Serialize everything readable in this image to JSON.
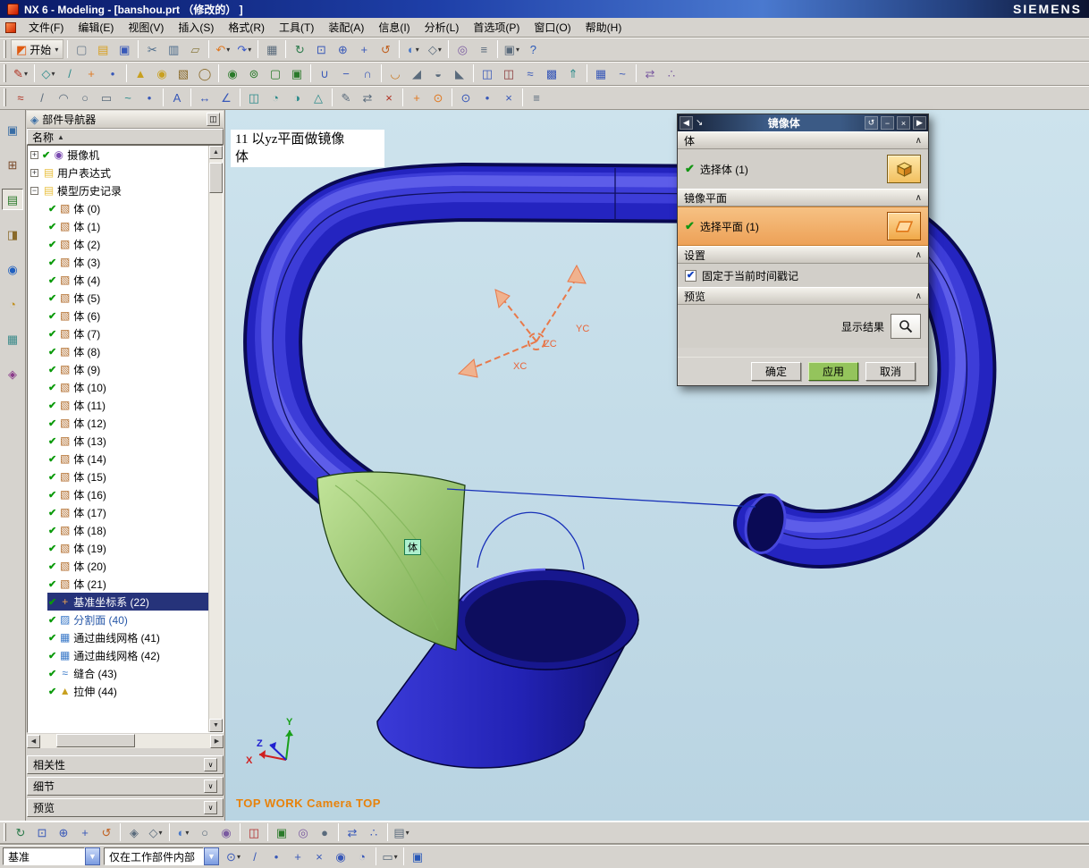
{
  "window": {
    "title": "NX 6 - Modeling - [banshou.prt （修改的） ]",
    "brand": "SIEMENS"
  },
  "glyphs": {
    "dd": "▾",
    "check": "✔",
    "up": "▲",
    "down": "▼",
    "left": "◀",
    "right": "▶",
    "sort": "▲",
    "panel": "∨"
  },
  "menubar": [
    {
      "n": "file",
      "label": "文件(F)"
    },
    {
      "n": "edit",
      "label": "编辑(E)"
    },
    {
      "n": "view",
      "label": "视图(V)"
    },
    {
      "n": "insert",
      "label": "插入(S)"
    },
    {
      "n": "format",
      "label": "格式(R)"
    },
    {
      "n": "tools",
      "label": "工具(T)"
    },
    {
      "n": "assemblies",
      "label": "装配(A)"
    },
    {
      "n": "information",
      "label": "信息(I)"
    },
    {
      "n": "analysis",
      "label": "分析(L)"
    },
    {
      "n": "preferences",
      "label": "首选项(P)"
    },
    {
      "n": "window",
      "label": "窗口(O)"
    },
    {
      "n": "help",
      "label": "帮助(H)"
    }
  ],
  "toolbars": {
    "row1": [
      {
        "t": "grip"
      },
      {
        "n": "start",
        "label": "开始",
        "g": "◩",
        "c": "#e05a10",
        "dd": true
      },
      {
        "t": "sep"
      },
      {
        "n": "new",
        "g": "▢",
        "c": "#6a7b8c"
      },
      {
        "n": "open",
        "g": "▤",
        "c": "#d8a020"
      },
      {
        "n": "save",
        "g": "▣",
        "c": "#3858b8"
      },
      {
        "t": "sep"
      },
      {
        "n": "cut",
        "g": "✂",
        "c": "#4a6a8a"
      },
      {
        "n": "copy",
        "g": "▥",
        "c": "#4a6a8a"
      },
      {
        "n": "paste",
        "g": "▱",
        "c": "#8a7a40"
      },
      {
        "t": "sep"
      },
      {
        "n": "undo",
        "g": "↶",
        "c": "#e07820",
        "dd": true
      },
      {
        "n": "redo",
        "g": "↷",
        "c": "#3858c8",
        "dd": true
      },
      {
        "t": "sep"
      },
      {
        "n": "print",
        "g": "▦",
        "c": "#5a6b7c"
      },
      {
        "t": "sep"
      },
      {
        "n": "refresh-display",
        "g": "↻",
        "c": "#2a7a4a"
      },
      {
        "n": "fit-window",
        "g": "⊡",
        "c": "#3858b8"
      },
      {
        "n": "zoom-in-out",
        "g": "⊕",
        "c": "#3858b8"
      },
      {
        "n": "pan",
        "g": "+",
        "c": "#3858b8"
      },
      {
        "n": "rotate-display",
        "g": "↺",
        "c": "#c06020"
      },
      {
        "t": "sep"
      },
      {
        "n": "shaded-display",
        "g": "◐",
        "c": "#4878c8",
        "dd": true
      },
      {
        "n": "wireframe-display",
        "g": "◇",
        "c": "#5a6b7c",
        "dd": true
      },
      {
        "t": "sep"
      },
      {
        "n": "show-and-hide",
        "g": "◎",
        "c": "#7a5aa0"
      },
      {
        "n": "layer-settings",
        "g": "≡",
        "c": "#5a6b7c"
      },
      {
        "t": "sep"
      },
      {
        "n": "window-menu",
        "g": "▣",
        "c": "#5a6b7c",
        "dd": true
      },
      {
        "n": "help",
        "g": "?",
        "c": "#2858b8"
      }
    ],
    "row2": [
      {
        "t": "grip"
      },
      {
        "n": "sketch",
        "g": "✎",
        "c": "#b03020",
        "dd": true
      },
      {
        "t": "sep"
      },
      {
        "n": "datum-plane",
        "g": "◇",
        "c": "#2a8a8a",
        "dd": true
      },
      {
        "n": "datum-axis",
        "g": "/",
        "c": "#2a8a8a"
      },
      {
        "n": "datum-csys",
        "g": "+",
        "c": "#e07820"
      },
      {
        "n": "point",
        "g": "•",
        "c": "#3858b8"
      },
      {
        "t": "sep"
      },
      {
        "n": "extrude",
        "g": "▲",
        "c": "#c8a020"
      },
      {
        "n": "revolve",
        "g": "◉",
        "c": "#c8a020"
      },
      {
        "n": "block",
        "g": "▧",
        "c": "#8a6a2a"
      },
      {
        "n": "cylinder",
        "g": "◯",
        "c": "#8a6a2a"
      },
      {
        "t": "sep"
      },
      {
        "n": "hole",
        "g": "◉",
        "c": "#2a7a2a"
      },
      {
        "n": "boss",
        "g": "⊚",
        "c": "#2a7a2a"
      },
      {
        "n": "pocket",
        "g": "▢",
        "c": "#2a7a2a"
      },
      {
        "n": "pad",
        "g": "▣",
        "c": "#2a7a2a"
      },
      {
        "t": "sep"
      },
      {
        "n": "unite",
        "g": "∪",
        "c": "#3858b8"
      },
      {
        "n": "subtract",
        "g": "−",
        "c": "#3858b8"
      },
      {
        "n": "intersect",
        "g": "∩",
        "c": "#3858b8"
      },
      {
        "t": "sep"
      },
      {
        "n": "edge-blend",
        "g": "◡",
        "c": "#c87820"
      },
      {
        "n": "chamfer",
        "g": "◢",
        "c": "#5a6b7c"
      },
      {
        "n": "shell",
        "g": "◒",
        "c": "#5a6b7c"
      },
      {
        "n": "draft",
        "g": "◣",
        "c": "#5a6b7c"
      },
      {
        "t": "sep"
      },
      {
        "n": "trim-body",
        "g": "◫",
        "c": "#3858b8"
      },
      {
        "n": "split-body",
        "g": "◫",
        "c": "#8a3a3a"
      },
      {
        "n": "sew",
        "g": "≈",
        "c": "#3858b8"
      },
      {
        "n": "patch",
        "g": "▩",
        "c": "#3858b8"
      },
      {
        "n": "offset-surface",
        "g": "⇑",
        "c": "#2a8a8a"
      },
      {
        "t": "sep"
      },
      {
        "n": "through-curve-mesh",
        "g": "▦",
        "c": "#3858b8"
      },
      {
        "n": "swept",
        "g": "~",
        "c": "#3858b8"
      },
      {
        "t": "sep"
      },
      {
        "n": "mirror-body",
        "g": "⇄",
        "c": "#7a5aa0"
      },
      {
        "n": "pattern-feature",
        "g": "∴",
        "c": "#7a5aa0"
      }
    ],
    "row3": [
      {
        "t": "grip"
      },
      {
        "n": "profile",
        "g": "≈",
        "c": "#b03020"
      },
      {
        "n": "line",
        "g": "/",
        "c": "#5a6b7c"
      },
      {
        "n": "arc",
        "g": "◠",
        "c": "#5a6b7c"
      },
      {
        "n": "circle",
        "g": "○",
        "c": "#5a6b7c"
      },
      {
        "n": "rectangle",
        "g": "▭",
        "c": "#5a6b7c"
      },
      {
        "n": "studio-spline",
        "g": "~",
        "c": "#2a8a8a"
      },
      {
        "n": "point-curve",
        "g": "•",
        "c": "#3858b8"
      },
      {
        "t": "sep"
      },
      {
        "n": "text",
        "g": "A",
        "c": "#3858b8"
      },
      {
        "t": "sep"
      },
      {
        "n": "measure-distance",
        "g": "↔",
        "c": "#3858b8"
      },
      {
        "n": "measure-angle",
        "g": "∠",
        "c": "#3858b8"
      },
      {
        "t": "sep"
      },
      {
        "n": "section-analysis",
        "g": "◫",
        "c": "#2a8a8a"
      },
      {
        "n": "curvature-analysis",
        "g": "◔",
        "c": "#2a8a8a"
      },
      {
        "n": "reflection-analysis",
        "g": "◑",
        "c": "#2a8a8a"
      },
      {
        "n": "draft-analysis",
        "g": "△",
        "c": "#2a8a8a"
      },
      {
        "t": "sep"
      },
      {
        "n": "edit-feature",
        "g": "✎",
        "c": "#5a6b7c"
      },
      {
        "n": "move-objects",
        "g": "⇄",
        "c": "#5a6b7c"
      },
      {
        "n": "delete",
        "g": "×",
        "c": "#b03020"
      },
      {
        "t": "sep"
      },
      {
        "n": "wcs-dynamics",
        "g": "+",
        "c": "#e07820"
      },
      {
        "n": "wcs-origin",
        "g": "⊙",
        "c": "#e07820"
      },
      {
        "t": "sep"
      },
      {
        "n": "snap-end-point",
        "g": "⊙",
        "c": "#3858b8"
      },
      {
        "n": "snap-mid-point",
        "g": "•",
        "c": "#3858b8"
      },
      {
        "n": "snap-intersection",
        "g": "×",
        "c": "#3858b8"
      },
      {
        "t": "sep"
      },
      {
        "n": "customize",
        "g": "≡",
        "c": "#5a6b7c"
      }
    ],
    "bottom": [
      {
        "t": "grip"
      },
      {
        "n": "refresh",
        "g": "↻",
        "c": "#2a7a4a"
      },
      {
        "n": "fit",
        "g": "⊡",
        "c": "#3858b8"
      },
      {
        "n": "zoom-view",
        "g": "⊕",
        "c": "#3858b8"
      },
      {
        "n": "pan-view",
        "g": "+",
        "c": "#3858b8"
      },
      {
        "n": "rotate-view",
        "g": "↺",
        "c": "#c06020"
      },
      {
        "t": "sep"
      },
      {
        "n": "perspective",
        "g": "◈",
        "c": "#5a6b7c"
      },
      {
        "n": "orient-view",
        "g": "◇",
        "c": "#5a6b7c",
        "dd": true
      },
      {
        "t": "sep"
      },
      {
        "n": "shaded-mode",
        "g": "◐",
        "c": "#4878c8",
        "dd": true
      },
      {
        "n": "wireframe-mode",
        "g": "○",
        "c": "#5a6b7c"
      },
      {
        "n": "studio-mode",
        "g": "◉",
        "c": "#7a5aa0"
      },
      {
        "t": "sep"
      },
      {
        "n": "clip-section",
        "g": "◫",
        "c": "#b03030"
      },
      {
        "t": "sep"
      },
      {
        "n": "edit-object-display",
        "g": "▣",
        "c": "#2a7a2a"
      },
      {
        "n": "show-hide-object",
        "g": "◎",
        "c": "#7a5aa0"
      },
      {
        "n": "immediate-hide",
        "g": "●",
        "c": "#5a6b7c"
      },
      {
        "t": "sep"
      },
      {
        "n": "move-object",
        "g": "⇄",
        "c": "#3858b8"
      },
      {
        "n": "pattern-object",
        "g": "∴",
        "c": "#3858b8"
      },
      {
        "t": "sep"
      },
      {
        "n": "object-preferences",
        "g": "▤",
        "c": "#5a6b7c",
        "dd": true
      }
    ],
    "status_icons": [
      {
        "n": "snap-point",
        "g": "⊙",
        "c": "#3858b8",
        "dd": true
      },
      {
        "n": "end-point",
        "g": "/",
        "c": "#3858b8"
      },
      {
        "n": "mid-point",
        "g": "•",
        "c": "#3858b8"
      },
      {
        "n": "control-point",
        "g": "+",
        "c": "#3858b8"
      },
      {
        "n": "intersection-point",
        "g": "×",
        "c": "#3858b8"
      },
      {
        "n": "arc-center",
        "g": "◉",
        "c": "#3858b8"
      },
      {
        "n": "quadrant-point",
        "g": "◔",
        "c": "#3858b8"
      },
      {
        "t": "sep"
      },
      {
        "n": "selection-rectangle",
        "g": "▭",
        "c": "#5a6b7c",
        "dd": true
      },
      {
        "t": "sep"
      },
      {
        "n": "wcs-toggle",
        "g": "▣",
        "c": "#2858b8"
      }
    ]
  },
  "resource": {
    "items": [
      {
        "n": "assembly-navigator",
        "g": "▣",
        "c": "#3a6ea5"
      },
      {
        "n": "constraint-navigator",
        "g": "⊞",
        "c": "#7a4a2a"
      },
      {
        "n": "part-navigator",
        "g": "▤",
        "c": "#2a7a2a",
        "active": true
      },
      {
        "n": "operation-navigator",
        "g": "◨",
        "c": "#8a6a2a"
      },
      {
        "n": "internet-explorer",
        "g": "◉",
        "c": "#2060c0"
      },
      {
        "n": "history",
        "g": "◔",
        "c": "#c09020"
      },
      {
        "n": "system-materials",
        "g": "▦",
        "c": "#3a8a8a"
      },
      {
        "n": "roles",
        "g": "◈",
        "c": "#8a3a8a"
      }
    ]
  },
  "navigator": {
    "title": "部件导航器",
    "name_column": "名称",
    "tree": [
      {
        "label": "摄像机",
        "exp": "+",
        "chk": true,
        "g": "◉",
        "c": "#7a4ab0",
        "lvl": 0
      },
      {
        "label": "用户表达式",
        "exp": "+",
        "g": "▤",
        "c": "#e8c040",
        "lvl": 0
      },
      {
        "label": "模型历史记录",
        "exp": "−",
        "g": "▤",
        "c": "#e8c040",
        "lvl": 0
      },
      {
        "label": "体 (0)",
        "chk": true,
        "g": "▧",
        "c": "#b06a28",
        "lvl": 1
      },
      {
        "label": "体 (1)",
        "chk": true,
        "g": "▧",
        "c": "#b06a28",
        "lvl": 1
      },
      {
        "label": "体 (2)",
        "chk": true,
        "g": "▧",
        "c": "#b06a28",
        "lvl": 1
      },
      {
        "label": "体 (3)",
        "chk": true,
        "g": "▧",
        "c": "#b06a28",
        "lvl": 1
      },
      {
        "label": "体 (4)",
        "chk": true,
        "g": "▧",
        "c": "#b06a28",
        "lvl": 1
      },
      {
        "label": "体 (5)",
        "chk": true,
        "g": "▧",
        "c": "#b06a28",
        "lvl": 1
      },
      {
        "label": "体 (6)",
        "chk": true,
        "g": "▧",
        "c": "#b06a28",
        "lvl": 1
      },
      {
        "label": "体 (7)",
        "chk": true,
        "g": "▧",
        "c": "#b06a28",
        "lvl": 1
      },
      {
        "label": "体 (8)",
        "chk": true,
        "g": "▧",
        "c": "#b06a28",
        "lvl": 1
      },
      {
        "label": "体 (9)",
        "chk": true,
        "g": "▧",
        "c": "#b06a28",
        "lvl": 1
      },
      {
        "label": "体 (10)",
        "chk": true,
        "g": "▧",
        "c": "#b06a28",
        "lvl": 1
      },
      {
        "label": "体 (11)",
        "chk": true,
        "g": "▧",
        "c": "#b06a28",
        "lvl": 1
      },
      {
        "label": "体 (12)",
        "chk": true,
        "g": "▧",
        "c": "#b06a28",
        "lvl": 1
      },
      {
        "label": "体 (13)",
        "chk": true,
        "g": "▧",
        "c": "#b06a28",
        "lvl": 1
      },
      {
        "label": "体 (14)",
        "chk": true,
        "g": "▧",
        "c": "#b06a28",
        "lvl": 1
      },
      {
        "label": "体 (15)",
        "chk": true,
        "g": "▧",
        "c": "#b06a28",
        "lvl": 1
      },
      {
        "label": "体 (16)",
        "chk": true,
        "g": "▧",
        "c": "#b06a28",
        "lvl": 1
      },
      {
        "label": "体 (17)",
        "chk": true,
        "g": "▧",
        "c": "#b06a28",
        "lvl": 1
      },
      {
        "label": "体 (18)",
        "chk": true,
        "g": "▧",
        "c": "#b06a28",
        "lvl": 1
      },
      {
        "label": "体 (19)",
        "chk": true,
        "g": "▧",
        "c": "#b06a28",
        "lvl": 1
      },
      {
        "label": "体 (20)",
        "chk": true,
        "g": "▧",
        "c": "#b06a28",
        "lvl": 1
      },
      {
        "label": "体 (21)",
        "chk": true,
        "g": "▧",
        "c": "#b06a28",
        "lvl": 1
      },
      {
        "label": "基准坐标系 (22)",
        "chk": true,
        "g": "+",
        "c": "#e8a050",
        "lvl": 1,
        "sel": true
      },
      {
        "label": "分割面 (40)",
        "chk": true,
        "g": "▨",
        "c": "#3878c8",
        "lvl": 1,
        "muted": true
      },
      {
        "label": "通过曲线网格 (41)",
        "chk": true,
        "g": "▦",
        "c": "#3878c8",
        "lvl": 1
      },
      {
        "label": "通过曲线网格 (42)",
        "chk": true,
        "g": "▦",
        "c": "#3878c8",
        "lvl": 1
      },
      {
        "label": "缝合 (43)",
        "chk": true,
        "g": "≈",
        "c": "#3878c8",
        "lvl": 1
      },
      {
        "label": "拉伸 (44)",
        "chk": true,
        "g": "▲",
        "c": "#c8a020",
        "lvl": 1
      }
    ],
    "panels": [
      {
        "n": "dependencies",
        "label": "相关性"
      },
      {
        "n": "details",
        "label": "细节"
      },
      {
        "n": "preview",
        "label": "预览"
      }
    ]
  },
  "viewport": {
    "annotation_lines": [
      "11 以yz平面做镜像",
      "体"
    ],
    "body_tag": "体",
    "camera_text": "TOP WORK Camera TOP",
    "wcs": {
      "xc": "XC",
      "yc": "YC",
      "zc": "ZC"
    },
    "triad": {
      "x": "X",
      "y": "Y",
      "z": "Z"
    }
  },
  "dialog": {
    "title": "镜像体",
    "icons": {
      "back": "◀",
      "forward": "▶",
      "reset": "↺",
      "minimize": "−",
      "close": "×",
      "drag": "↘",
      "collapse": "∧"
    },
    "sections": {
      "group_body": "体",
      "select_body": "选择体 (1)",
      "group_plane": "镜像平面",
      "select_plane": "选择平面 (1)",
      "group_settings": "设置",
      "fix_timestamp": "固定于当前时间戳记",
      "group_preview": "预览",
      "show_result": "显示结果"
    },
    "buttons": {
      "ok": "确定",
      "apply": "应用",
      "cancel": "取消"
    }
  },
  "statusbar": {
    "type_filter": "基准",
    "scope_filter": "仅在工作部件内部"
  }
}
